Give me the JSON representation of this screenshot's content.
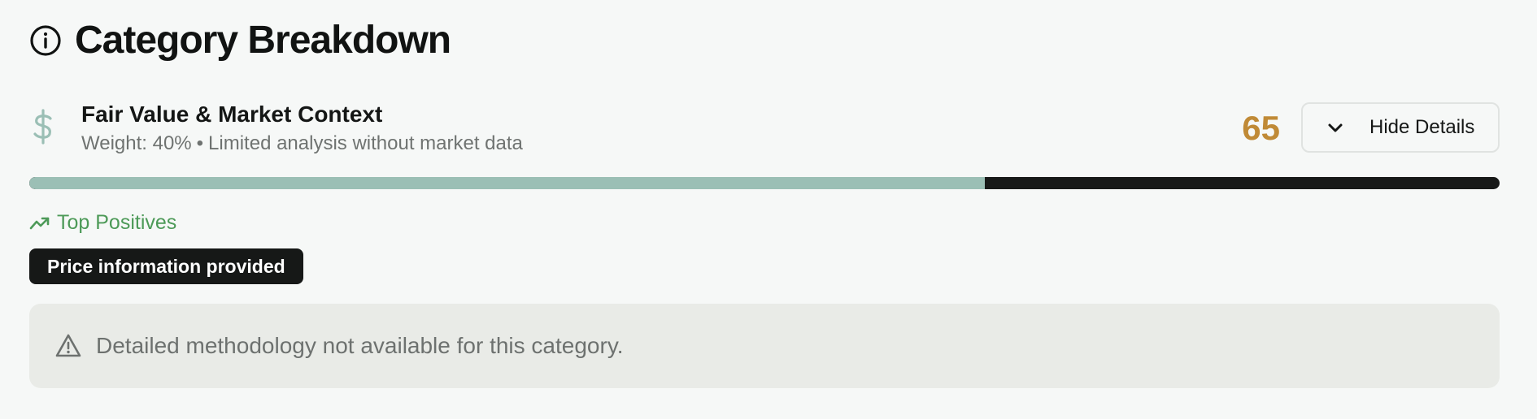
{
  "header": {
    "title": "Category Breakdown",
    "icon": "info-icon"
  },
  "category": {
    "icon": "dollar-icon",
    "name": "Fair Value & Market Context",
    "weight_text": "Weight: 40%",
    "separator": "•",
    "note": "Limited analysis without market data",
    "score": "65",
    "score_fraction": 0.65,
    "toggle_label": "Hide Details",
    "toggle_icon": "chevron-down-icon"
  },
  "positives": {
    "heading": "Top Positives",
    "icon": "trending-up-icon",
    "items": [
      "Price information provided"
    ]
  },
  "notice": {
    "icon": "warning-icon",
    "text": "Detailed methodology not available for this category."
  },
  "colors": {
    "background": "#f6f8f7",
    "score": "#c08a36",
    "progress_fill": "#9bbfb5",
    "progress_track": "#171918",
    "positive": "#4d9a58",
    "pill_background": "#161817",
    "notice_background": "#e9ebe7"
  }
}
